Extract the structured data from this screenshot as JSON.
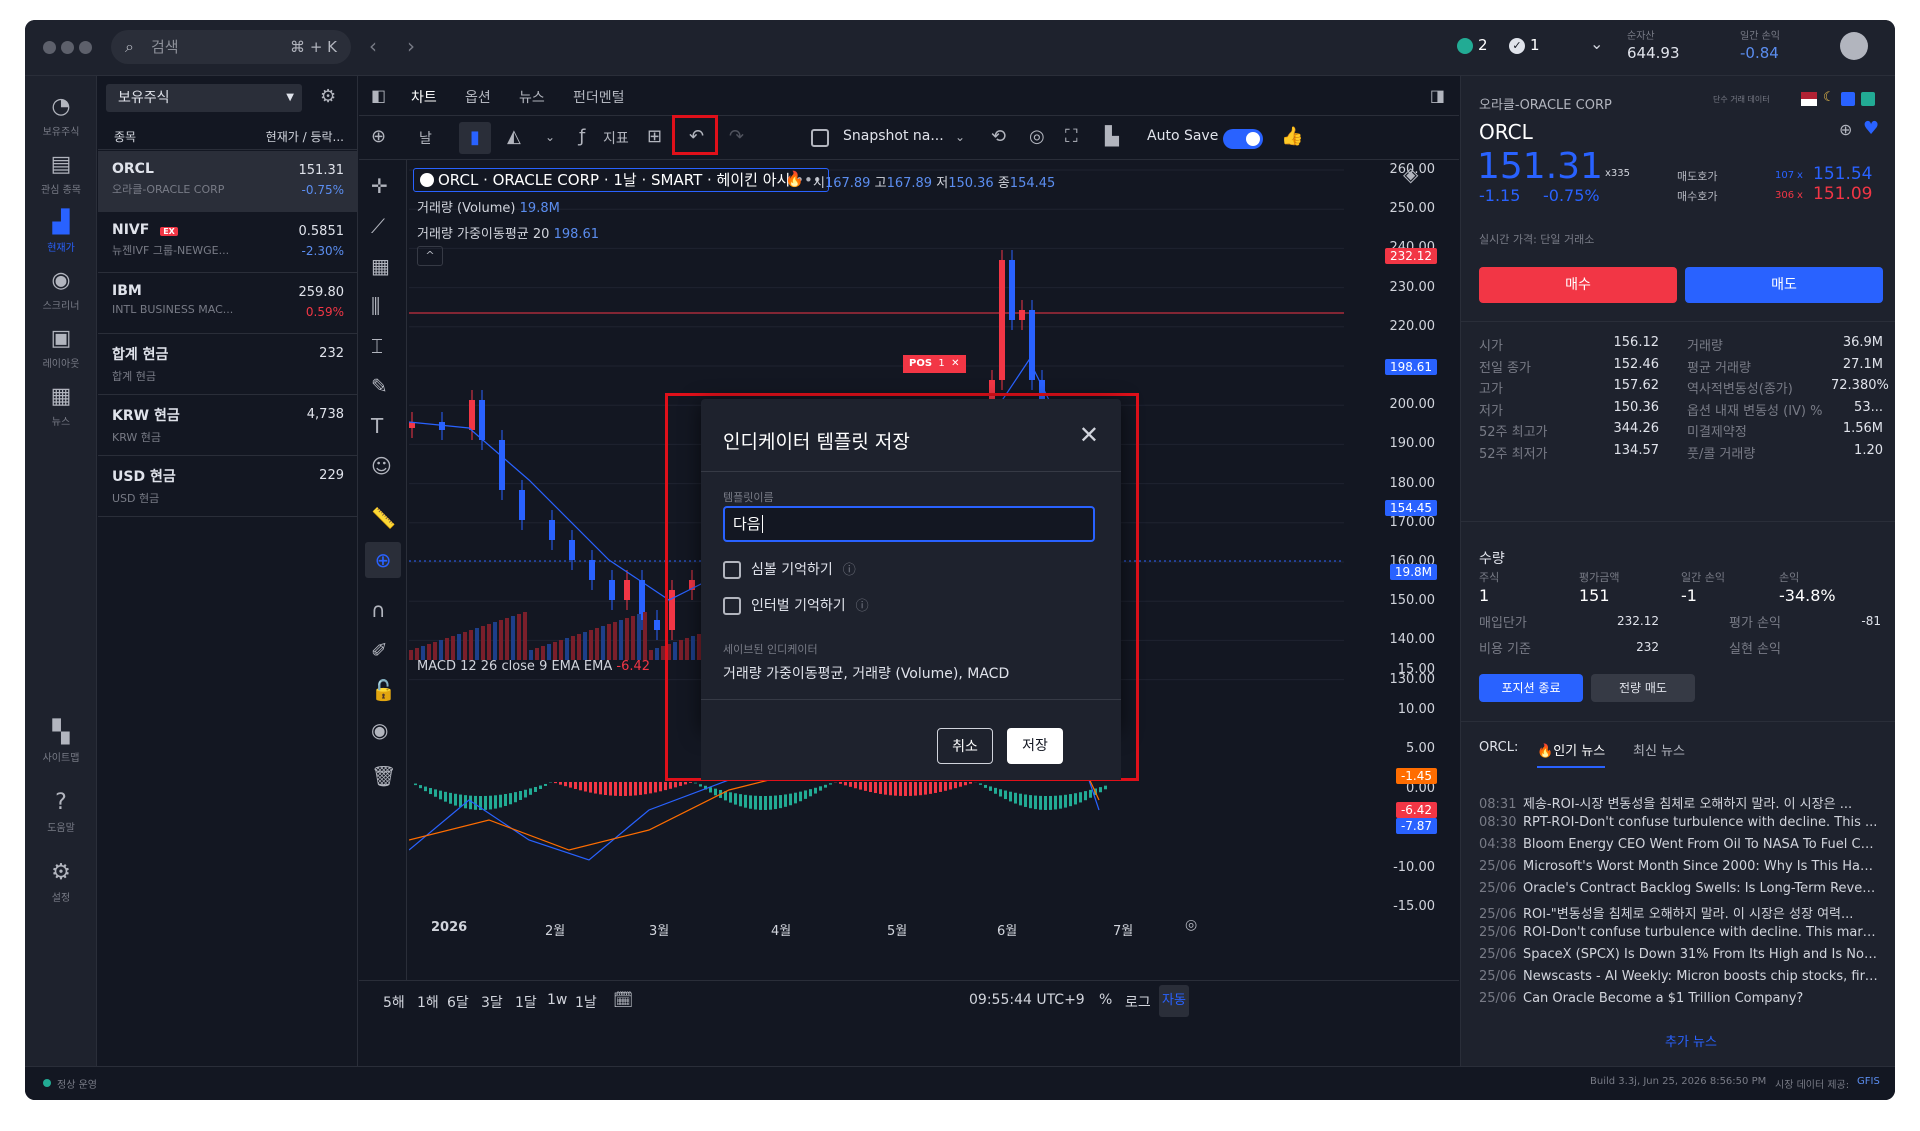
{
  "search": {
    "placeholder": "검색",
    "shortcut": "⌘ + K"
  },
  "header": {
    "green_count": "2",
    "check_count": "1",
    "net_assets_label": "순자산",
    "net_assets": "644.93",
    "daily_pnl_label": "일간 손익",
    "daily_pnl": "-0.84"
  },
  "rail": [
    {
      "label": "보유주식",
      "icon": "pie-chart-icon"
    },
    {
      "label": "관심 종목",
      "icon": "watchlist-icon"
    },
    {
      "label": "현재가",
      "icon": "bar-chart-icon"
    },
    {
      "label": "스크리너",
      "icon": "globe-icon"
    },
    {
      "label": "레이아웃",
      "icon": "layout-icon"
    },
    {
      "label": "뉴스",
      "icon": "news-icon"
    },
    {
      "label": "사이트맵",
      "icon": "sitemap-icon"
    },
    {
      "label": "도움말",
      "icon": "help-icon"
    },
    {
      "label": "설정",
      "icon": "gear-icon"
    }
  ],
  "watchlist": {
    "selector": "보유주식",
    "col_symbol": "종목",
    "col_price": "현재가 / 등락...",
    "rows": [
      {
        "sym": "ORCL",
        "name": "오라클-ORACLE CORP",
        "price": "151.31",
        "chg": "-0.75%",
        "badge": ""
      },
      {
        "sym": "NIVF",
        "name": "뉴젠IVF 그룹-NEWGE...",
        "price": "0.5851",
        "chg": "-2.30%",
        "badge": "EX"
      },
      {
        "sym": "IBM",
        "name": "INTL BUSINESS MAC...",
        "price": "259.80",
        "chg": "0.59%",
        "badge": ""
      },
      {
        "sym": "합계 현금",
        "name": "합계 현금",
        "price": "232",
        "chg": "",
        "badge": ""
      },
      {
        "sym": "KRW 현금",
        "name": "KRW 현금",
        "price": "4,738",
        "chg": "",
        "badge": ""
      },
      {
        "sym": "USD 현금",
        "name": "USD 현금",
        "price": "229",
        "chg": "",
        "badge": ""
      }
    ]
  },
  "chart_tabs": [
    "차트",
    "옵션",
    "뉴스",
    "펀더멘털"
  ],
  "toolbar": {
    "interval": "날",
    "indicators": "지표",
    "snapshot": "Snapshot na...",
    "autosave": "Auto Save"
  },
  "legend": {
    "title": "ORCL · ORACLE CORP · 1날 · SMART · 헤이킨 아시",
    "o_label": "시",
    "o": "167.89",
    "h_label": "고",
    "h": "167.89",
    "l_label": "저",
    "l": "150.36",
    "c_label": "종",
    "c": "154.45",
    "vol_label": "거래량 (Volume)",
    "vol": "19.8M",
    "vma_label": "거래량 가중이동평균 20",
    "vma": "198.61",
    "macd_label": "MACD 12 26 close 9 EMA EMA",
    "macd": "-6.42"
  },
  "pos_tag": {
    "label": "POS",
    "qty": "1"
  },
  "price_axis": [
    "260.00",
    "250.00",
    "240.00",
    "230.00",
    "220.00",
    "210.00",
    "200.00",
    "190.00",
    "180.00",
    "170.00",
    "160.00",
    "150.00",
    "140.00",
    "130.00"
  ],
  "price_tags": [
    {
      "v": "232.12",
      "c": "#f23645"
    },
    {
      "v": "198.61",
      "c": "#2962ff"
    },
    {
      "v": "154.45",
      "c": "#2962ff"
    },
    {
      "v": "19.8M",
      "c": "#2962ff"
    }
  ],
  "macd_axis": [
    "15.00",
    "10.00",
    "5.00",
    "0.00",
    "-5.00",
    "-10.00",
    "-15.00"
  ],
  "macd_tags": [
    {
      "v": "-1.45",
      "c": "#ff6d00"
    },
    {
      "v": "-6.42",
      "c": "#f23645"
    },
    {
      "v": "-7.87",
      "c": "#2962ff"
    }
  ],
  "time_axis": [
    "2026",
    "2월",
    "3월",
    "4월",
    "5월",
    "6월",
    "7월"
  ],
  "ranges": [
    "5해",
    "1해",
    "6달",
    "3달",
    "1달",
    "1w",
    "1날"
  ],
  "clock": "09:55:44 UTC+9",
  "bottom_right": {
    "pct": "%",
    "log": "로그",
    "auto": "자동"
  },
  "modal": {
    "title": "인디케이터 템플릿 저장",
    "name_label": "템플릿이름",
    "name_value": "다음",
    "cb1": "심볼 기억하기",
    "cb2": "인터벌 기억하기",
    "saved_label": "세이브된 인디케이터",
    "saved_value": "거래량 가중이동평균, 거래량 (Volume), MACD",
    "cancel": "취소",
    "save": "저장"
  },
  "quote": {
    "name": "오라클-ORACLE CORP",
    "data_label": "단수 거래 데이터",
    "sym": "ORCL",
    "price": "151.31",
    "size": "x335",
    "chg": "-1.15",
    "chg_pct": "-0.75%",
    "ask_label": "매도호가",
    "ask_size": "107",
    "ask": "151.54",
    "bid_label": "매수호가",
    "bid_size": "306",
    "bid": "151.09",
    "realtime": "실시간 가격: 단일 거래소",
    "buy": "매수",
    "sell": "매도"
  },
  "stats_left": [
    [
      "시가",
      "156.12"
    ],
    [
      "전일 종가",
      "152.46"
    ],
    [
      "고가",
      "157.62"
    ],
    [
      "저가",
      "150.36"
    ],
    [
      "52주 최고가",
      "344.26"
    ],
    [
      "52주 최저가",
      "134.57"
    ]
  ],
  "stats_right": [
    [
      "거래량",
      "36.9M"
    ],
    [
      "평균 거래량",
      "27.1M"
    ],
    [
      "역사적변동성(종가)",
      "72.380%"
    ],
    [
      "옵션 내재 변동성 (IV) %",
      "53..."
    ],
    [
      "미결제약정",
      "1.56M"
    ],
    [
      "풋/콜 거래량",
      "1.20"
    ]
  ],
  "position": {
    "title": "수량",
    "shares_label": "주식",
    "shares": "1",
    "value_label": "평가금액",
    "value": "151",
    "daily_label": "일간 손익",
    "daily": "-1",
    "pnl_label": "손익",
    "pnl": "-34.8%",
    "avg_label": "매입단가",
    "avg": "232.12",
    "unreal_label": "평가 손익",
    "unreal": "-81",
    "cost_label": "비용 기준",
    "cost": "232",
    "real_label": "실현 손익",
    "real": "",
    "close_btn": "포지션 종료",
    "sellall_btn": "전량 매도"
  },
  "news": {
    "sym": "ORCL:",
    "tab1": "인기 뉴스",
    "tab2": "최신 뉴스",
    "more": "추가 뉴스",
    "items": [
      {
        "t": "08:31",
        "h": "제송-ROI-시장 변동성을 침체로 오해하지 말라. 이 시장은 ..."
      },
      {
        "t": "08:30",
        "h": "RPT-ROI-Don't confuse turbulence with decline. This ..."
      },
      {
        "t": "04:38",
        "h": "Bloom Energy CEO Went From Oil To NASA To Fuel Cel..."
      },
      {
        "t": "25/06",
        "h": "Microsoft's Worst Month Since 2000: Why Is This Happ..."
      },
      {
        "t": "25/06",
        "h": "Oracle's Contract Backlog Swells: Is Long-Term Reven..."
      },
      {
        "t": "25/06",
        "h": "ROI-\"변동성을 침체로 오해하지 말라. 이 시장은 성장 여력..."
      },
      {
        "t": "25/06",
        "h": "ROI-Don't confuse turbulence with decline. This mark..."
      },
      {
        "t": "25/06",
        "h": "SpaceX (SPCX) Is Down 31% From Its High and Is Now ..."
      },
      {
        "t": "25/06",
        "h": "Newscasts - AI Weekly: Micron boosts chip stocks, firm..."
      },
      {
        "t": "25/06",
        "h": "Can Oracle Become a $1 Trillion Company?"
      }
    ]
  },
  "status": {
    "left": "정상 운영",
    "build": "Build 3.3j, Jun 25, 2026 8:56:50 PM",
    "data": "시장 데이터 제공:",
    "provider": "GFIS"
  }
}
